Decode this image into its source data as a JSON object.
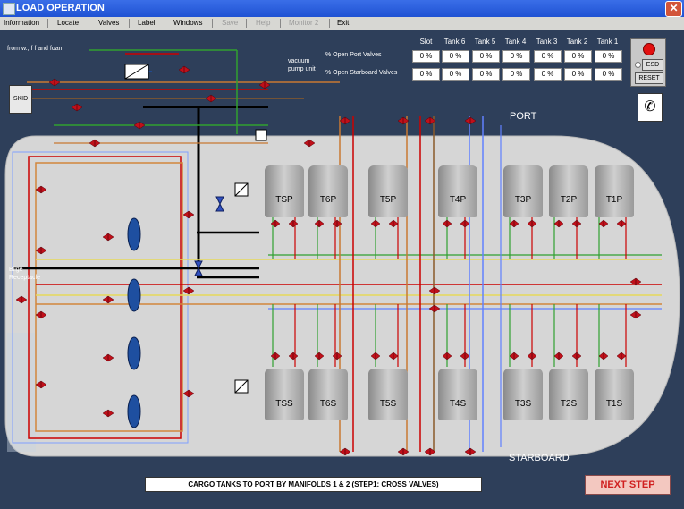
{
  "window": {
    "title": "LOAD OPERATION",
    "close_glyph": "✕"
  },
  "menu": [
    {
      "label": "Information",
      "enabled": true
    },
    {
      "label": "Locate",
      "enabled": true
    },
    {
      "label": "Valves",
      "enabled": true
    },
    {
      "label": "Label",
      "enabled": true
    },
    {
      "label": "Windows",
      "enabled": true
    },
    {
      "label": "Save",
      "enabled": false
    },
    {
      "label": "Help",
      "enabled": false
    },
    {
      "label": "Monitor 2",
      "enabled": false
    },
    {
      "label": "Exit",
      "enabled": true
    }
  ],
  "valve_table": {
    "columns": [
      "Slot",
      "Tank 6",
      "Tank 5",
      "Tank 4",
      "Tank 3",
      "Tank 2",
      "Tank 1"
    ],
    "rows": [
      {
        "label": "% Open Port Valves",
        "values": [
          "0 %",
          "0 %",
          "0 %",
          "0 %",
          "0 %",
          "0 %",
          "0 %"
        ]
      },
      {
        "label": "% Open Starboard Valves",
        "values": [
          "0 %",
          "0 %",
          "0 %",
          "0 %",
          "0 %",
          "0 %",
          "0 %"
        ]
      }
    ]
  },
  "esd": {
    "esd_label": "ESD",
    "reset_label": "RESET"
  },
  "labels": {
    "from": "from w., f f and foam",
    "vacuum": [
      "vacuum",
      "pump unit"
    ],
    "skid": "SKID",
    "bilge": [
      "Bilge",
      "Receptacle"
    ],
    "port": "PORT",
    "starboard": "STARBOARD"
  },
  "tanks_port": [
    "TSP",
    "T6P",
    "T5P",
    "T4P",
    "T3P",
    "T2P",
    "T1P"
  ],
  "tanks_starboard": [
    "TSS",
    "T6S",
    "T5S",
    "T4S",
    "T3S",
    "T2S",
    "T1S"
  ],
  "status_text": "CARGO TANKS TO PORT BY MANIFOLDS 1 & 2 (STEP1: CROSS VALVES)",
  "next_button": "NEXT STEP",
  "icons": {
    "phone": "phone-icon",
    "esd_indicator": "red-alarm-light-icon"
  },
  "colors": {
    "background": "#2e3f5a",
    "hull": "#d6d6d6",
    "valve": "#c0101a",
    "pump": "#1e4fa0",
    "pipe_black": "#000000",
    "pipe_orange": "#c87832",
    "pipe_green": "#30a030",
    "pipe_yellow": "#e6d95a",
    "pipe_red": "#e01010",
    "pipe_blue": "#6080ff",
    "pipe_brown": "#8a5a2a"
  }
}
